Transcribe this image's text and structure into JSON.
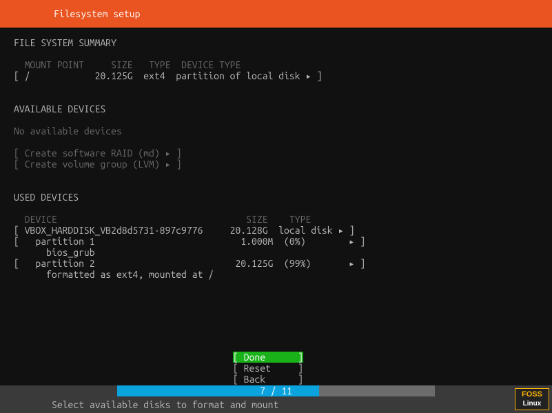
{
  "header": {
    "title": "Filesystem setup"
  },
  "sections": {
    "summary_title": "FILE SYSTEM SUMMARY",
    "summary_headers": {
      "mount": "MOUNT POINT",
      "size": "SIZE",
      "type": "TYPE",
      "devtype": "DEVICE TYPE"
    },
    "summary_row": {
      "mount": "/",
      "size": "20.125G",
      "type": "ext4",
      "devtype": "partition of local disk"
    },
    "available_title": "AVAILABLE DEVICES",
    "no_avail": "No available devices",
    "create_raid": "Create software RAID (md)",
    "create_lvm": "Create volume group (LVM)",
    "used_title": "USED DEVICES",
    "used_headers": {
      "device": "DEVICE",
      "size": "SIZE",
      "type": "TYPE"
    },
    "disk": {
      "name": "VBOX_HARDDISK_VB2d8d5731-897c9776",
      "size": "20.128G",
      "type": "local disk"
    },
    "part1": {
      "name": "partition 1",
      "size": "1.000M",
      "pct": "(0%)",
      "desc": "bios_grub"
    },
    "part2": {
      "name": "partition 2",
      "size": "20.125G",
      "pct": "(99%)",
      "desc": "formatted as ext4, mounted at /"
    }
  },
  "buttons": {
    "done": "Done",
    "reset": "Reset",
    "back": "Back"
  },
  "progress": {
    "label": "7 / 11",
    "current": 7,
    "total": 11
  },
  "hint": "Select available disks to format and mount",
  "watermark": {
    "l1": "FOSS",
    "l2": "Linux"
  },
  "glyph": {
    "arrow": "▸"
  }
}
